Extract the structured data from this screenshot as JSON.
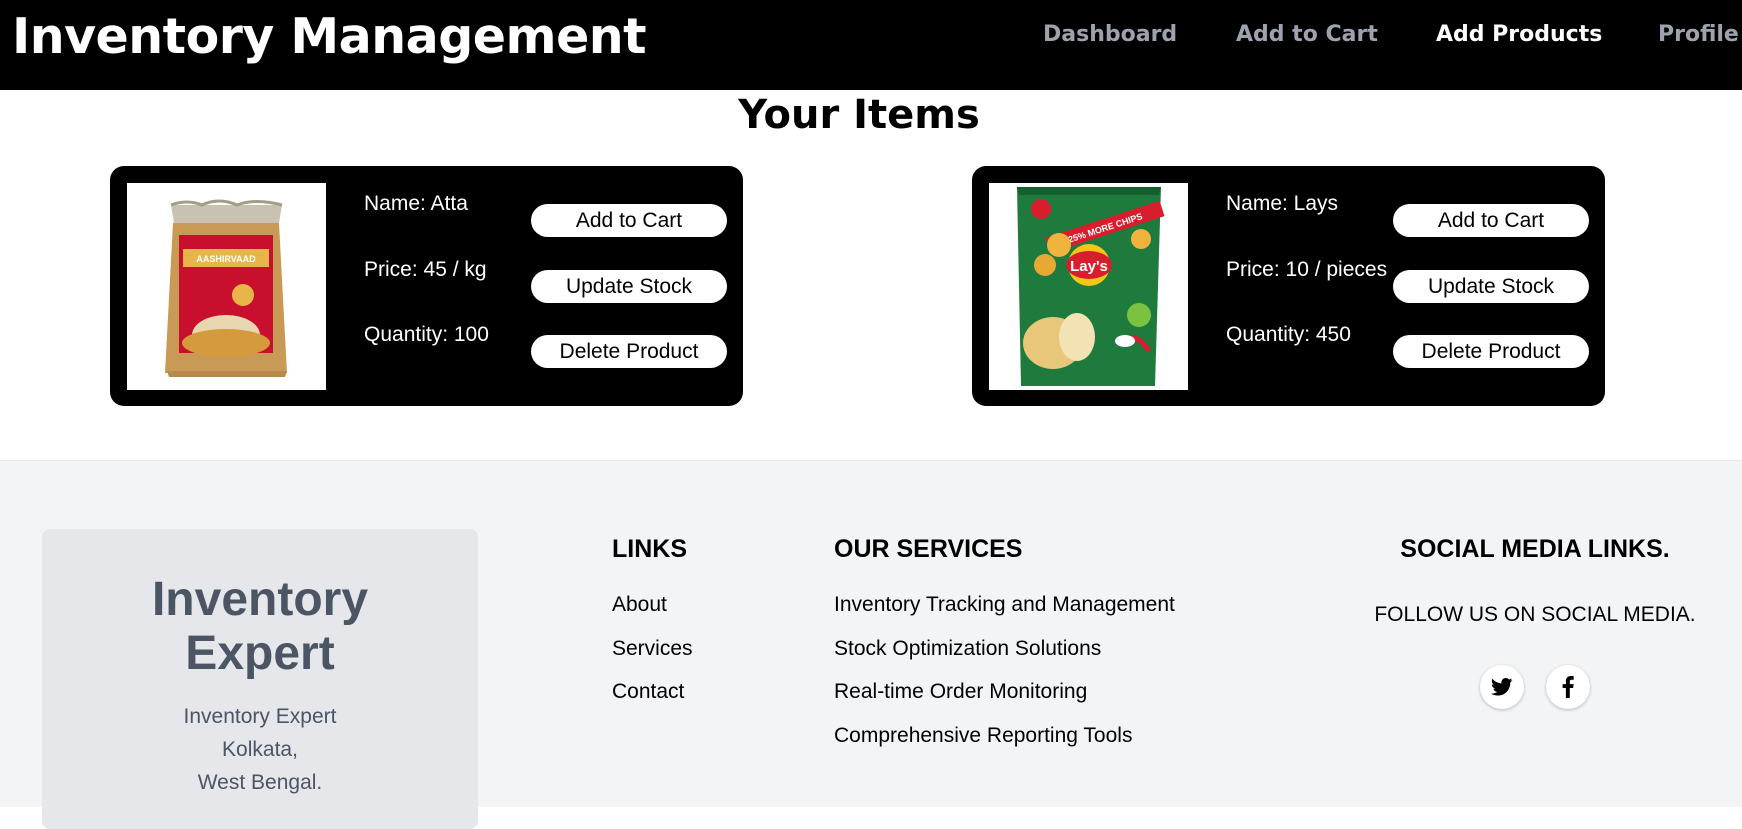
{
  "header": {
    "title": "Inventory Management",
    "nav": [
      {
        "label": "Dashboard",
        "active": false
      },
      {
        "label": "Add to Cart",
        "active": false
      },
      {
        "label": "Add Products",
        "active": true
      },
      {
        "label": "Profile",
        "active": false
      }
    ]
  },
  "main": {
    "title": "Your Items",
    "items": [
      {
        "name_line": "Name: Atta",
        "price_line": "Price: 45 / kg",
        "quantity_line": "Quantity: 100",
        "image": "aashirvaad-atta-pack",
        "image_brand": "AASHIRVAAD"
      },
      {
        "name_line": "Name: Lays",
        "price_line": "Price: 10 / pieces",
        "quantity_line": "Quantity: 450",
        "image": "lays-chips-pack",
        "image_brand": "Lay's",
        "image_banner": "25% MORE CHIPS"
      }
    ],
    "buttons": {
      "add_to_cart": "Add to Cart",
      "update_stock": "Update Stock",
      "delete_product": "Delete Product"
    }
  },
  "footer": {
    "about": {
      "title_line1": "Inventory",
      "title_line2": "Expert",
      "lines": [
        "Inventory Expert",
        "Kolkata,",
        "West Bengal."
      ]
    },
    "links": {
      "heading": "LINKS",
      "items": [
        "About",
        "Services",
        "Contact"
      ]
    },
    "services": {
      "heading": "OUR SERVICES",
      "items": [
        "Inventory Tracking and Management",
        "Stock Optimization Solutions",
        "Real-time Order Monitoring",
        "Comprehensive Reporting Tools"
      ]
    },
    "social": {
      "heading": "SOCIAL MEDIA LINKS.",
      "subheading": "FOLLOW US ON SOCIAL MEDIA.",
      "icons": [
        "twitter-icon",
        "facebook-icon"
      ]
    }
  },
  "colors": {
    "navbar_bg": "#000000",
    "nav_inactive": "#9ca3af",
    "nav_active": "#ffffff",
    "card_bg": "#000000",
    "footer_bg": "#f3f4f6",
    "about_box_bg": "#e5e7eb",
    "about_text": "#4b5563"
  }
}
